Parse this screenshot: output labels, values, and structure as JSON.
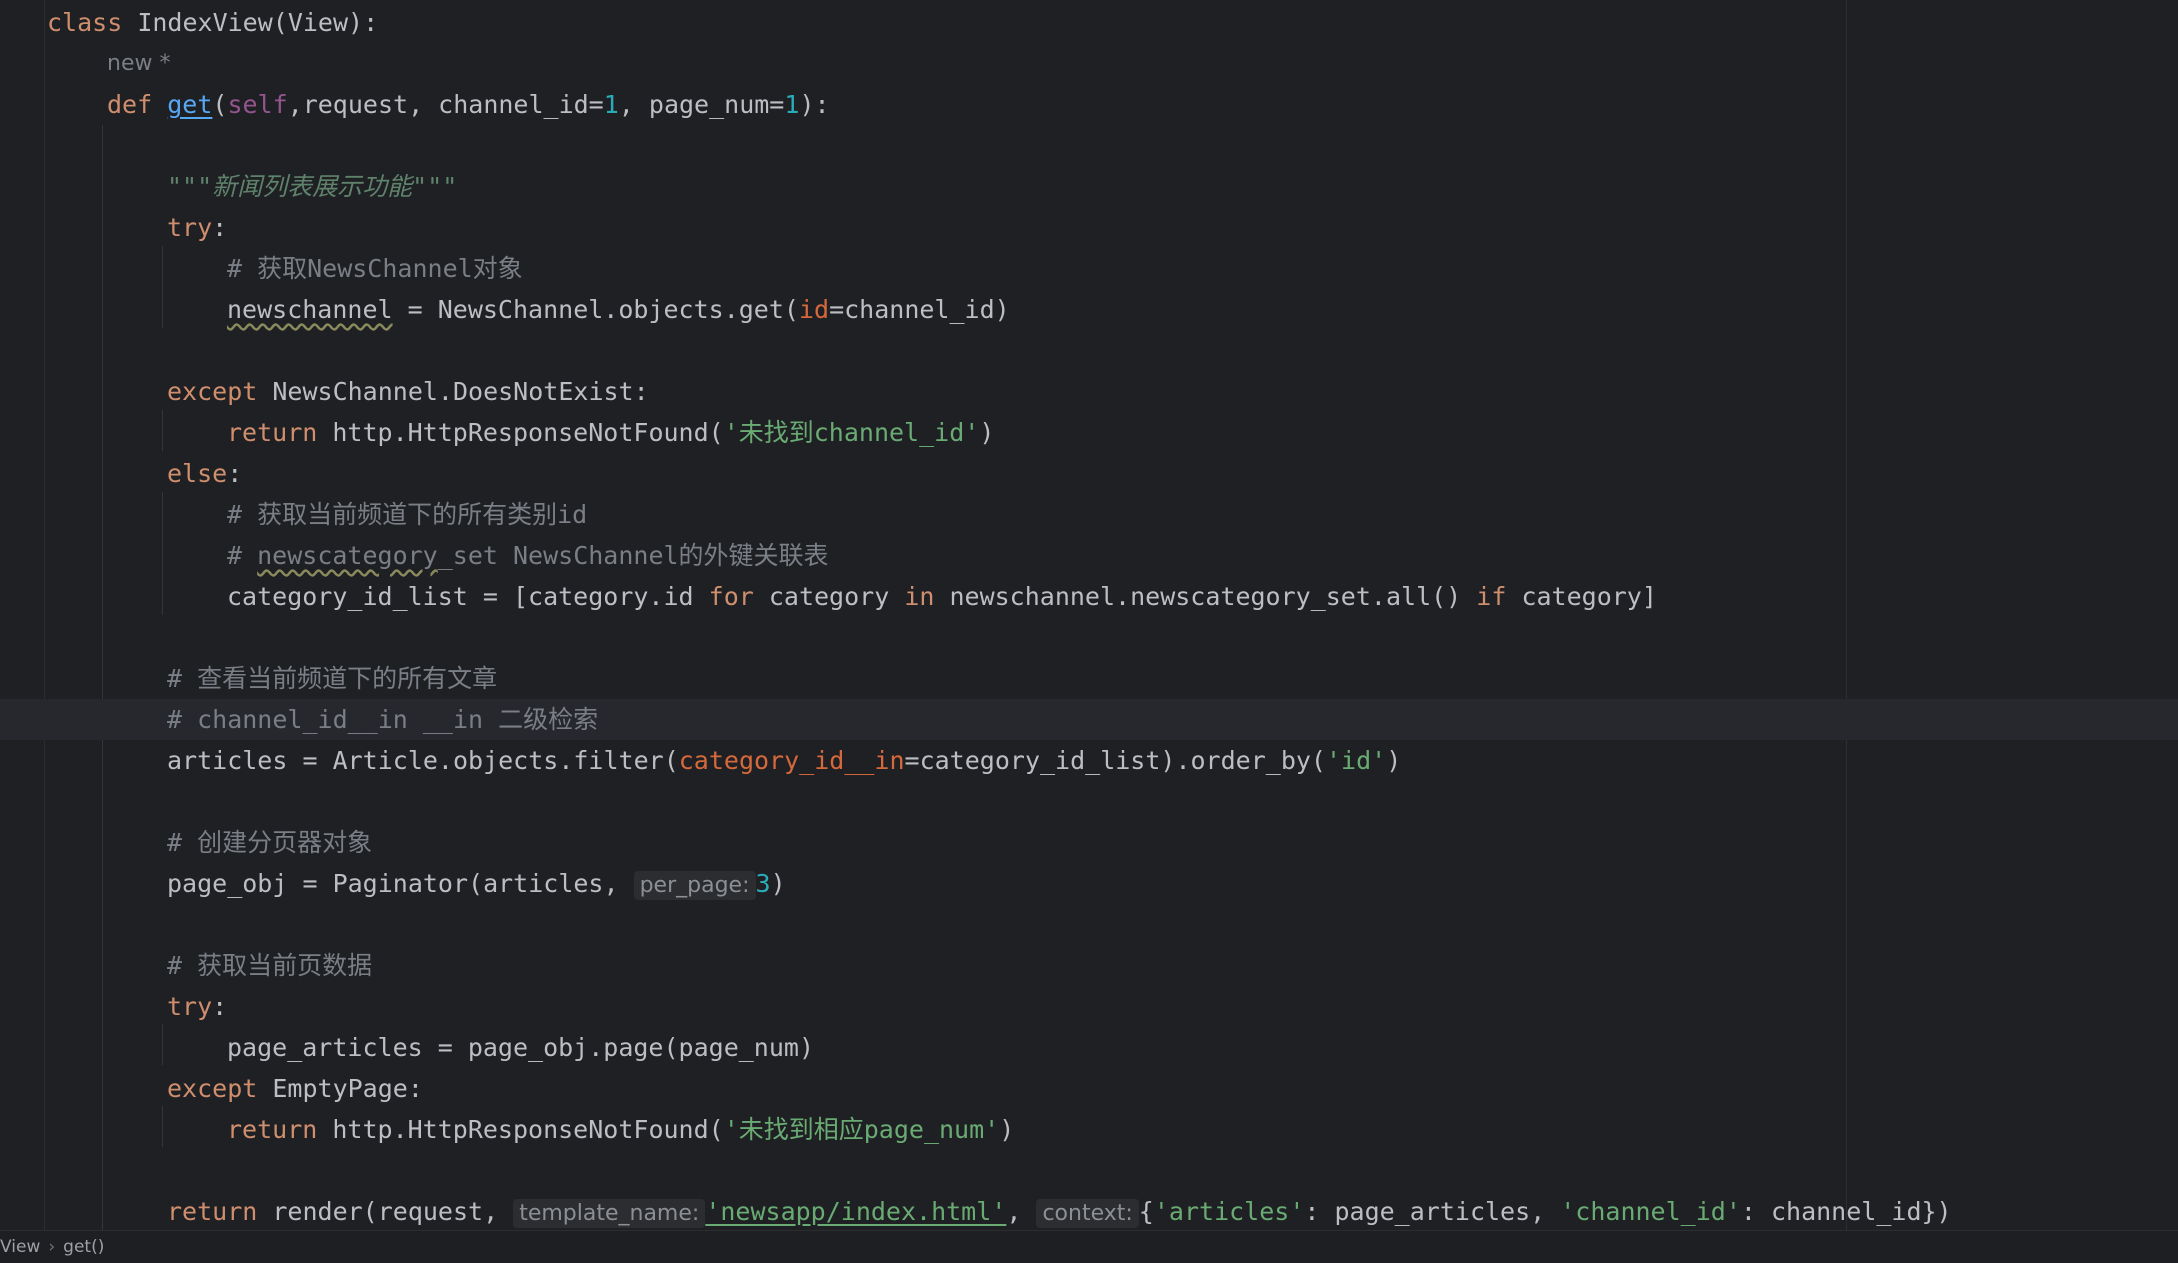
{
  "editor": {
    "lines": {
      "l1": {
        "kw": "class",
        "rest": " IndexView(View):"
      },
      "l2": {
        "inlay": "new *"
      },
      "l3": {
        "kw": "def",
        "fn": "get",
        "self": "self",
        "p1": ",request, channel_id=",
        "n1": "1",
        "p2": ", page_num=",
        "n2": "1",
        "p3": "):"
      },
      "l5": {
        "doc": "\"\"\"新闻列表展示功能\"\"\""
      },
      "l6": {
        "kw": "try",
        "rest": ":"
      },
      "l7": {
        "cmt": "# 获取NewsChannel对象"
      },
      "l8": {
        "var": "newschannel",
        "a": " = NewsChannel.objects.get(",
        "named": "id",
        "b": "=channel_id)"
      },
      "l10": {
        "kw": "except",
        "rest": " NewsChannel.DoesNotExist:"
      },
      "l11": {
        "kw": "return",
        "a": " http.HttpResponseNotFound(",
        "str": "'未找到channel_id'",
        "b": ")"
      },
      "l12": {
        "kw": "else",
        "rest": ":"
      },
      "l13": {
        "cmt": "# 获取当前频道下的所有类别id"
      },
      "l14": {
        "c1": "# ",
        "c2": "newscategory",
        "c3": "_set NewsChannel的外键关联表"
      },
      "l15": {
        "a": "category_id_list = [category.id ",
        "k1": "for",
        "b": " category ",
        "k2": "in",
        "c": " newschannel.newscategory_set.all() ",
        "k3": "if",
        "d": " category]"
      },
      "l17": {
        "cmt": "# 查看当前频道下的所有文章"
      },
      "l18": {
        "cmt": "# channel_id__in __in 二级检索"
      },
      "l19": {
        "a": "articles = Article.objects.filter(",
        "named": "category_id__in",
        "b": "=category_id_list).order_by(",
        "str": "'id'",
        "c": ")"
      },
      "l21": {
        "cmt": "# 创建分页器对象"
      },
      "l22": {
        "a": "page_obj = Paginator(articles, ",
        "hint": "per_page:",
        "num": "3",
        "b": ")"
      },
      "l24": {
        "cmt": "# 获取当前页数据"
      },
      "l25": {
        "kw": "try",
        "rest": ":"
      },
      "l26": {
        "a": "page_articles = page_obj.page(page_num)"
      },
      "l27": {
        "kw": "except",
        "rest": " EmptyPage:"
      },
      "l28": {
        "kw": "return",
        "a": " http.HttpResponseNotFound(",
        "str": "'未找到相应page_num'",
        "b": ")"
      },
      "l30": {
        "kw": "return",
        "a": " render(request, ",
        "hint1": "template_name:",
        "s1": "'newsapp/index.html'",
        "b": ", ",
        "hint2": "context:",
        "c": "{",
        "s2": "'articles'",
        "d": ": page_articles, ",
        "s3": "'channel_id'",
        "e": ": channel_id})"
      }
    }
  },
  "breadcrumb": {
    "item1": "View",
    "sep": "›",
    "item2": "get()"
  }
}
